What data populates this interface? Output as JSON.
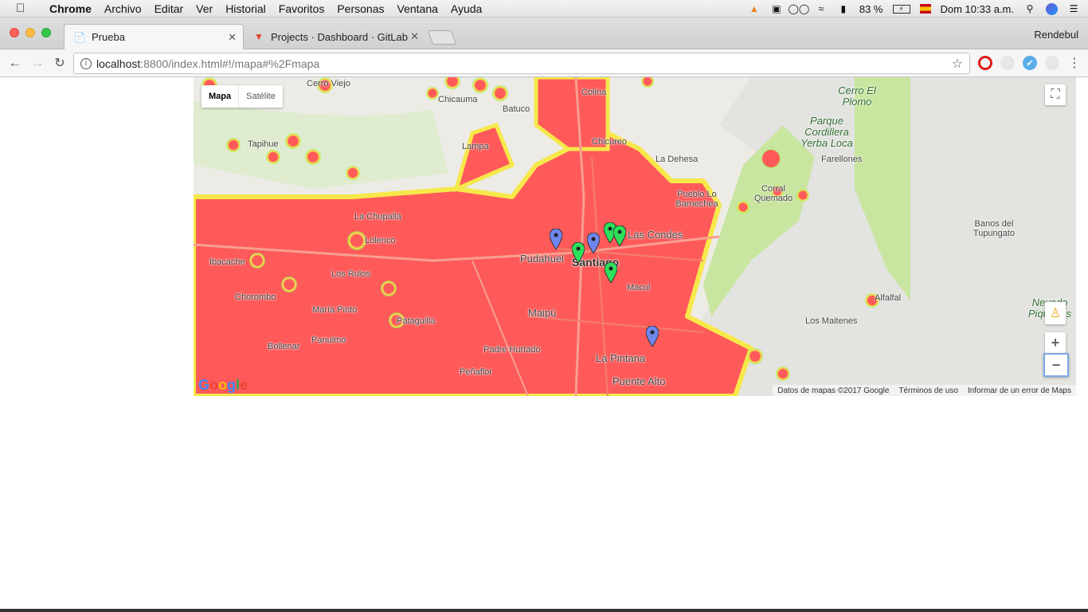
{
  "menubar": {
    "items": [
      "Chrome",
      "Archivo",
      "Editar",
      "Ver",
      "Historial",
      "Favoritos",
      "Personas",
      "Ventana",
      "Ayuda"
    ],
    "battery": "83 %",
    "clock": "Dom 10:33 a.m.",
    "icons": [
      "apple-icon",
      "wifi-icon",
      "volume-icon",
      "battery-icon",
      "flag-icon",
      "search-icon",
      "siri-icon",
      "list-icon"
    ]
  },
  "tabs": [
    {
      "title": "Prueba",
      "icon": "page-icon",
      "active": true
    },
    {
      "title": "Projects · Dashboard · GitLab",
      "icon": "gitlab-icon",
      "active": false
    }
  ],
  "profile": "Rendebul",
  "address": {
    "host": "localhost",
    "path": ":8800/index.html#!/mapa#%2Fmapa"
  },
  "map": {
    "type_buttons": [
      "Mapa",
      "Satélite"
    ],
    "selected_type": "Mapa",
    "attribution": [
      "Datos de mapas ©2017 Google",
      "Términos de uso",
      "Informar de un error de Maps"
    ],
    "google_logo": "Google",
    "places": [
      "Cerro Viejo",
      "Colina",
      "Chicauma",
      "Batuco",
      "Lampa",
      "Chicureo",
      "Tapihue",
      "La Dehesa",
      "Pueblo Lo Barnechea",
      "Corral Quemado",
      "Farellones",
      "La Chupalla",
      "Lolenco",
      "Las Condes",
      "Pudahuel",
      "Santiago",
      "Ibacache",
      "Los Rulos",
      "Macul",
      "Chorombo",
      "María Pinto",
      "Maipú",
      "Pataguilla",
      "Bollenar",
      "Panulmo",
      "Padre Hurtado",
      "La Pintana",
      "Peñaflor",
      "Puente Alto",
      "Los Maitenes",
      "Alfalfal",
      "Banos del Tupungato",
      "Cerro El Plomo",
      "Parque Cordillera Yerba Loca",
      "Nevado Piquenes",
      "Colina"
    ],
    "heatmap_color": "#ff5a5a",
    "marker_colors": {
      "blue": "#6f86f0",
      "green": "#2ee05a"
    },
    "markers": [
      {
        "color": "blue"
      },
      {
        "color": "blue"
      },
      {
        "color": "green"
      },
      {
        "color": "green"
      },
      {
        "color": "green"
      },
      {
        "color": "green"
      },
      {
        "color": "blue"
      }
    ]
  }
}
